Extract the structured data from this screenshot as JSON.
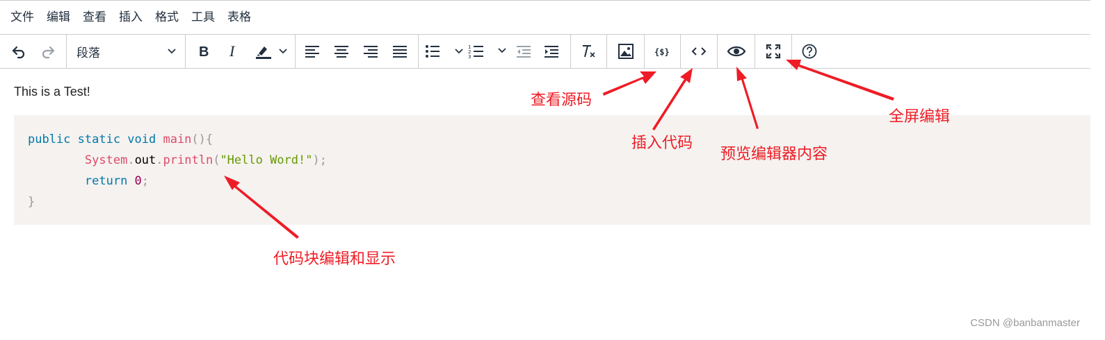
{
  "menubar": {
    "items": [
      "文件",
      "编辑",
      "查看",
      "插入",
      "格式",
      "工具",
      "表格"
    ]
  },
  "toolbar": {
    "blocks_value": "段落",
    "icons": [
      "undo-icon",
      "redo-icon",
      "bold-icon",
      "italic-icon",
      "highlight-icon",
      "align-left-icon",
      "align-center-icon",
      "align-right-icon",
      "align-justify-icon",
      "bullet-list-icon",
      "numbered-list-icon",
      "outdent-icon",
      "indent-icon",
      "clear-formatting-icon",
      "image-icon",
      "source-code-icon",
      "code-sample-icon",
      "preview-icon",
      "fullscreen-icon",
      "help-icon"
    ]
  },
  "content": {
    "paragraph": "This is a Test!",
    "code": {
      "line1_kw": "public static void ",
      "line1_fn": "main",
      "line1_punc": "(){",
      "line2_cls": "System",
      "line2_dot1": ".",
      "line2_out": "out",
      "line2_dot2": ".",
      "line2_fn": "println",
      "line2_open": "(",
      "line2_str": "\"Hello Word!\"",
      "line2_close": ");",
      "line3_kw": "return ",
      "line3_num": "0",
      "line3_semi": ";",
      "line4": "}"
    }
  },
  "annotations": {
    "view_source": "查看源码",
    "insert_code": "插入代码",
    "preview": "预览编辑器内容",
    "fullscreen": "全屏编辑",
    "code_block": "代码块编辑和显示"
  },
  "watermark": "CSDN @banbanmaster",
  "colors": {
    "annotation": "#ee1c25",
    "code_background": "#f5f2f0",
    "keyword": "#0077aa",
    "function": "#dd4a68",
    "string": "#669900",
    "number": "#990055"
  }
}
